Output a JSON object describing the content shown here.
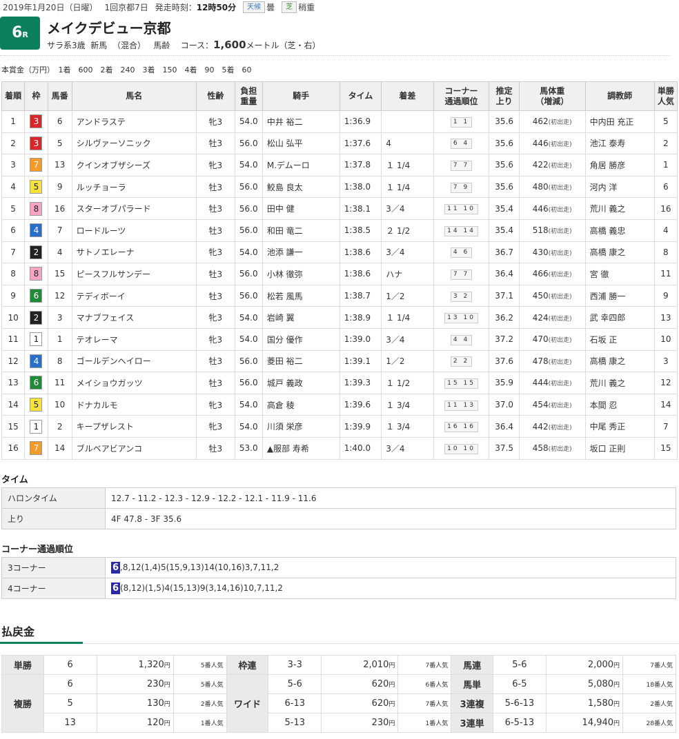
{
  "header": {
    "date": "2019年1月20日（日曜）",
    "meeting": "1回京都7日",
    "post_label": "発走時刻：",
    "post_time": "12時50分",
    "weather_label": "天候",
    "weather": "曇",
    "track_label": "芝",
    "track_cond": "稍重",
    "race_no": "6",
    "race_no_suffix": "R",
    "race_name": "メイクデビュー京都",
    "cond1": "サラ系3歳",
    "cond2": "新馬",
    "cond3": "（混合）",
    "cond4": "馬齢",
    "course_label": "コース：",
    "distance": "1,600",
    "course_unit": "メートル（芝・右）",
    "prize": "本賞金（万円）　1着　600　2着　240　3着　150　4着　90　5着　60"
  },
  "columns": [
    "着順",
    "枠",
    "馬番",
    "馬名",
    "性齢",
    "負担\n重量",
    "騎手",
    "タイム",
    "着差",
    "コーナー\n通過順位",
    "推定\n上り",
    "馬体重\n（増減）",
    "調教師",
    "単勝\n人気"
  ],
  "colors": {
    "1": "#ffffff",
    "2": "#222222",
    "3": "#d7282d",
    "4": "#2a6fc7",
    "5": "#f5e23a",
    "6": "#1e8a3a",
    "7": "#f59b2a",
    "8": "#f5a5c3",
    "green": "#0b7f5c"
  },
  "results": [
    {
      "pos": "1",
      "waku": "3",
      "num": "6",
      "name": "アンドラステ",
      "sex": "牝3",
      "wt": "54.0",
      "jockey": "中井 裕二",
      "time": "1:36.9",
      "margin": "",
      "corner": "1 1",
      "last": "35.6",
      "bw": "462",
      "bwd": "(初出走)",
      "trainer": "中内田 充正",
      "pop": "5"
    },
    {
      "pos": "2",
      "waku": "3",
      "num": "5",
      "name": "シルヴァーソニック",
      "sex": "牡3",
      "wt": "56.0",
      "jockey": "松山 弘平",
      "time": "1:37.6",
      "margin": "4",
      "corner": "6 4",
      "last": "35.6",
      "bw": "446",
      "bwd": "(初出走)",
      "trainer": "池江 泰寿",
      "pop": "2"
    },
    {
      "pos": "3",
      "waku": "7",
      "num": "13",
      "name": "クインオブザシーズ",
      "sex": "牝3",
      "wt": "54.0",
      "jockey": "M.デムーロ",
      "time": "1:37.8",
      "margin": "１ 1/4",
      "corner": "7 7",
      "last": "35.6",
      "bw": "422",
      "bwd": "(初出走)",
      "trainer": "角居 勝彦",
      "pop": "1"
    },
    {
      "pos": "4",
      "waku": "5",
      "num": "9",
      "name": "ルッチョーラ",
      "sex": "牡3",
      "wt": "56.0",
      "jockey": "鮫島 良太",
      "time": "1:38.0",
      "margin": "１ 1/4",
      "corner": "7 9",
      "last": "35.6",
      "bw": "480",
      "bwd": "(初出走)",
      "trainer": "河内 洋",
      "pop": "6"
    },
    {
      "pos": "5",
      "waku": "8",
      "num": "16",
      "name": "スターオブパラード",
      "sex": "牡3",
      "wt": "56.0",
      "jockey": "田中 健",
      "time": "1:38.1",
      "margin": "3／4",
      "corner": "11 10",
      "last": "35.4",
      "bw": "446",
      "bwd": "(初出走)",
      "trainer": "荒川 義之",
      "pop": "16"
    },
    {
      "pos": "6",
      "waku": "4",
      "num": "7",
      "name": "ロードルーツ",
      "sex": "牡3",
      "wt": "56.0",
      "jockey": "和田 竜二",
      "time": "1:38.5",
      "margin": "２ 1/2",
      "corner": "14 14",
      "last": "35.4",
      "bw": "518",
      "bwd": "(初出走)",
      "trainer": "高橋 義忠",
      "pop": "4"
    },
    {
      "pos": "7",
      "waku": "2",
      "num": "4",
      "name": "サトノエレーナ",
      "sex": "牝3",
      "wt": "54.0",
      "jockey": "池添 謙一",
      "time": "1:38.6",
      "margin": "3／4",
      "corner": "4 6",
      "last": "36.7",
      "bw": "430",
      "bwd": "(初出走)",
      "trainer": "高橋 康之",
      "pop": "8"
    },
    {
      "pos": "8",
      "waku": "8",
      "num": "15",
      "name": "ピースフルサンデー",
      "sex": "牡3",
      "wt": "56.0",
      "jockey": "小林 徹弥",
      "time": "1:38.6",
      "margin": "ハナ",
      "corner": "7 7",
      "last": "36.4",
      "bw": "466",
      "bwd": "(初出走)",
      "trainer": "宮 徹",
      "pop": "11"
    },
    {
      "pos": "9",
      "waku": "6",
      "num": "12",
      "name": "テディボーイ",
      "sex": "牡3",
      "wt": "56.0",
      "jockey": "松若 風馬",
      "time": "1:38.7",
      "margin": "1／2",
      "corner": "3 2",
      "last": "37.1",
      "bw": "450",
      "bwd": "(初出走)",
      "trainer": "西浦 勝一",
      "pop": "9"
    },
    {
      "pos": "10",
      "waku": "2",
      "num": "3",
      "name": "マナブフェイス",
      "sex": "牝3",
      "wt": "54.0",
      "jockey": "岩崎 翼",
      "time": "1:38.9",
      "margin": "１ 1/4",
      "corner": "13 10",
      "last": "36.2",
      "bw": "424",
      "bwd": "(初出走)",
      "trainer": "武 幸四郎",
      "pop": "13"
    },
    {
      "pos": "11",
      "waku": "1",
      "num": "1",
      "name": "テオレーマ",
      "sex": "牝3",
      "wt": "54.0",
      "jockey": "国分 優作",
      "time": "1:39.0",
      "margin": "3／4",
      "corner": "4 4",
      "last": "37.2",
      "bw": "470",
      "bwd": "(初出走)",
      "trainer": "石坂 正",
      "pop": "10"
    },
    {
      "pos": "12",
      "waku": "4",
      "num": "8",
      "name": "ゴールデンヘイロー",
      "sex": "牡3",
      "wt": "56.0",
      "jockey": "菱田 裕二",
      "time": "1:39.1",
      "margin": "1／2",
      "corner": "2 2",
      "last": "37.6",
      "bw": "478",
      "bwd": "(初出走)",
      "trainer": "高橋 康之",
      "pop": "3"
    },
    {
      "pos": "13",
      "waku": "6",
      "num": "11",
      "name": "メイショウガッツ",
      "sex": "牡3",
      "wt": "56.0",
      "jockey": "城戸 義政",
      "time": "1:39.3",
      "margin": "１ 1/2",
      "corner": "15 15",
      "last": "35.9",
      "bw": "444",
      "bwd": "(初出走)",
      "trainer": "荒川 義之",
      "pop": "12"
    },
    {
      "pos": "14",
      "waku": "5",
      "num": "10",
      "name": "ドナカルモ",
      "sex": "牝3",
      "wt": "54.0",
      "jockey": "高倉 稜",
      "time": "1:39.6",
      "margin": "１ 3/4",
      "corner": "11 13",
      "last": "37.0",
      "bw": "454",
      "bwd": "(初出走)",
      "trainer": "本間 忍",
      "pop": "14"
    },
    {
      "pos": "15",
      "waku": "1",
      "num": "2",
      "name": "キープザレスト",
      "sex": "牝3",
      "wt": "54.0",
      "jockey": "川須 栄彦",
      "time": "1:39.9",
      "margin": "１ 3/4",
      "corner": "16 16",
      "last": "36.4",
      "bw": "442",
      "bwd": "(初出走)",
      "trainer": "中尾 秀正",
      "pop": "7"
    },
    {
      "pos": "16",
      "waku": "7",
      "num": "14",
      "name": "ブルベアビアンコ",
      "sex": "牡3",
      "wt": "53.0",
      "jockey": "▲服部 寿希",
      "time": "1:40.0",
      "margin": "3／4",
      "corner": "10 10",
      "last": "37.5",
      "bw": "458",
      "bwd": "(初出走)",
      "trainer": "坂口 正則",
      "pop": "15"
    }
  ],
  "time_section": {
    "title": "タイム",
    "halon_label": "ハロンタイム",
    "halon": "12.7 - 11.2 - 12.3 - 12.9 - 12.2 - 12.1 - 11.9 - 11.6",
    "agari_label": "上り",
    "agari": "4F 47.8 - 3F 35.6"
  },
  "corner_section": {
    "title": "コーナー通過順位",
    "c3_label": "3コーナー",
    "c3_lead": "6",
    "c3": ",8,12(1,4)5(15,9,13)14(10,16)3,7,11,2",
    "c4_label": "4コーナー",
    "c4_lead": "6",
    "c4": "(8,12)(1,5)4(15,13)9(3,14,16)10,7,11,2"
  },
  "payout": {
    "title": "払戻金",
    "unit": "円",
    "tansho": {
      "label": "単勝",
      "num": "6",
      "amt": "1,320",
      "pop": "5番人気"
    },
    "fukusho": {
      "label": "複勝",
      "rows": [
        {
          "num": "6",
          "amt": "230",
          "pop": "5番人気"
        },
        {
          "num": "5",
          "amt": "130",
          "pop": "2番人気"
        },
        {
          "num": "13",
          "amt": "120",
          "pop": "1番人気"
        }
      ]
    },
    "wakuren": {
      "label": "枠連",
      "num": "3-3",
      "amt": "2,010",
      "pop": "7番人気"
    },
    "wide": {
      "label": "ワイド",
      "rows": [
        {
          "num": "5-6",
          "amt": "620",
          "pop": "6番人気"
        },
        {
          "num": "6-13",
          "amt": "620",
          "pop": "7番人気"
        },
        {
          "num": "5-13",
          "amt": "230",
          "pop": "1番人気"
        }
      ]
    },
    "umaren": {
      "label": "馬連",
      "num": "5-6",
      "amt": "2,000",
      "pop": "7番人気"
    },
    "umatan": {
      "label": "馬単",
      "num": "6-5",
      "amt": "5,080",
      "pop": "18番人気"
    },
    "sanrenpuku": {
      "label": "3連複",
      "num": "5-6-13",
      "amt": "1,580",
      "pop": "2番人気"
    },
    "sanrentan": {
      "label": "3連単",
      "num": "6-5-13",
      "amt": "14,940",
      "pop": "28番人気"
    }
  }
}
